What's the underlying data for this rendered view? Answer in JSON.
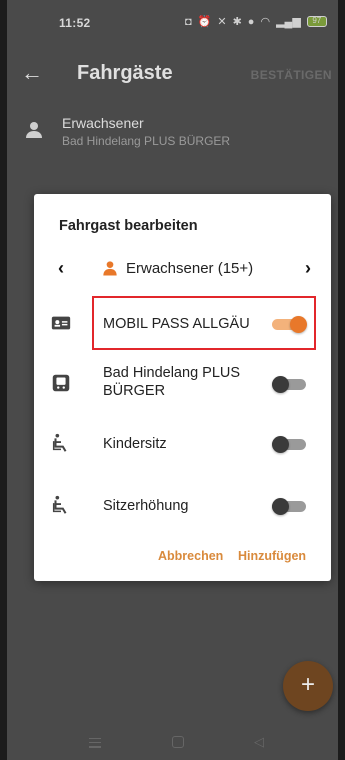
{
  "status_bar": {
    "time": "11:52",
    "battery": "97"
  },
  "app_bar": {
    "title": "Fahrgäste",
    "confirm_label": "BESTÄTIGEN"
  },
  "passenger": {
    "type": "Erwachsener",
    "ticket": "Bad Hindelang PLUS BÜRGER",
    "icon": "person-icon"
  },
  "dialog": {
    "title": "Fahrgast bearbeiten",
    "selected_type": "Erwachsener (15+)",
    "options": [
      {
        "label": "MOBIL PASS ALLGÄU",
        "icon": "id-card-icon",
        "enabled": true
      },
      {
        "label": "Bad Hindelang PLUS BÜRGER",
        "icon": "bus-card-icon",
        "enabled": false
      },
      {
        "label": "Kindersitz",
        "icon": "child-seat-icon",
        "enabled": false
      },
      {
        "label": "Sitzerhöhung",
        "icon": "booster-seat-icon",
        "enabled": false
      }
    ],
    "cancel_label": "Abbrechen",
    "add_label": "Hinzufügen"
  },
  "colors": {
    "accent": "#e8782a",
    "highlight": "#e2262b"
  }
}
